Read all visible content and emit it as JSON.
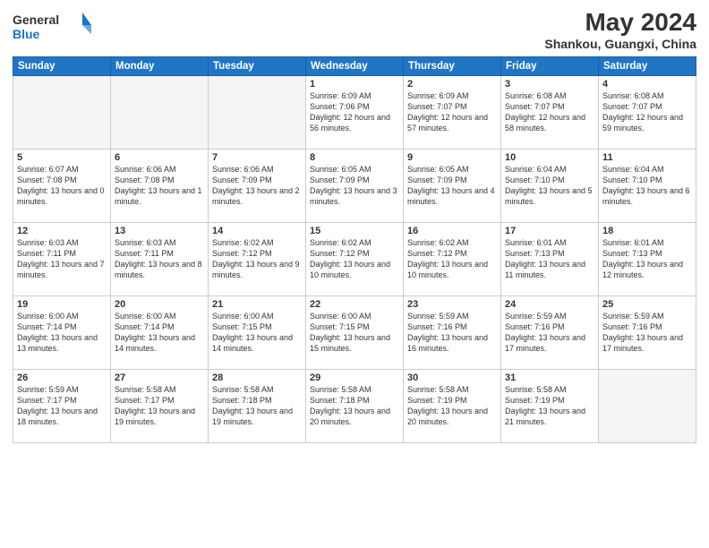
{
  "header": {
    "logo_line1": "General",
    "logo_line2": "Blue",
    "month_year": "May 2024",
    "location": "Shankou, Guangxi, China"
  },
  "weekdays": [
    "Sunday",
    "Monday",
    "Tuesday",
    "Wednesday",
    "Thursday",
    "Friday",
    "Saturday"
  ],
  "weeks": [
    [
      {
        "day": "",
        "sunrise": "",
        "sunset": "",
        "daylight": "",
        "empty": true
      },
      {
        "day": "",
        "sunrise": "",
        "sunset": "",
        "daylight": "",
        "empty": true
      },
      {
        "day": "",
        "sunrise": "",
        "sunset": "",
        "daylight": "",
        "empty": true
      },
      {
        "day": "1",
        "sunrise": "Sunrise: 6:09 AM",
        "sunset": "Sunset: 7:06 PM",
        "daylight": "Daylight: 12 hours and 56 minutes.",
        "empty": false
      },
      {
        "day": "2",
        "sunrise": "Sunrise: 6:09 AM",
        "sunset": "Sunset: 7:07 PM",
        "daylight": "Daylight: 12 hours and 57 minutes.",
        "empty": false
      },
      {
        "day": "3",
        "sunrise": "Sunrise: 6:08 AM",
        "sunset": "Sunset: 7:07 PM",
        "daylight": "Daylight: 12 hours and 58 minutes.",
        "empty": false
      },
      {
        "day": "4",
        "sunrise": "Sunrise: 6:08 AM",
        "sunset": "Sunset: 7:07 PM",
        "daylight": "Daylight: 12 hours and 59 minutes.",
        "empty": false
      }
    ],
    [
      {
        "day": "5",
        "sunrise": "Sunrise: 6:07 AM",
        "sunset": "Sunset: 7:08 PM",
        "daylight": "Daylight: 13 hours and 0 minutes.",
        "empty": false
      },
      {
        "day": "6",
        "sunrise": "Sunrise: 6:06 AM",
        "sunset": "Sunset: 7:08 PM",
        "daylight": "Daylight: 13 hours and 1 minute.",
        "empty": false
      },
      {
        "day": "7",
        "sunrise": "Sunrise: 6:06 AM",
        "sunset": "Sunset: 7:09 PM",
        "daylight": "Daylight: 13 hours and 2 minutes.",
        "empty": false
      },
      {
        "day": "8",
        "sunrise": "Sunrise: 6:05 AM",
        "sunset": "Sunset: 7:09 PM",
        "daylight": "Daylight: 13 hours and 3 minutes.",
        "empty": false
      },
      {
        "day": "9",
        "sunrise": "Sunrise: 6:05 AM",
        "sunset": "Sunset: 7:09 PM",
        "daylight": "Daylight: 13 hours and 4 minutes.",
        "empty": false
      },
      {
        "day": "10",
        "sunrise": "Sunrise: 6:04 AM",
        "sunset": "Sunset: 7:10 PM",
        "daylight": "Daylight: 13 hours and 5 minutes.",
        "empty": false
      },
      {
        "day": "11",
        "sunrise": "Sunrise: 6:04 AM",
        "sunset": "Sunset: 7:10 PM",
        "daylight": "Daylight: 13 hours and 6 minutes.",
        "empty": false
      }
    ],
    [
      {
        "day": "12",
        "sunrise": "Sunrise: 6:03 AM",
        "sunset": "Sunset: 7:11 PM",
        "daylight": "Daylight: 13 hours and 7 minutes.",
        "empty": false
      },
      {
        "day": "13",
        "sunrise": "Sunrise: 6:03 AM",
        "sunset": "Sunset: 7:11 PM",
        "daylight": "Daylight: 13 hours and 8 minutes.",
        "empty": false
      },
      {
        "day": "14",
        "sunrise": "Sunrise: 6:02 AM",
        "sunset": "Sunset: 7:12 PM",
        "daylight": "Daylight: 13 hours and 9 minutes.",
        "empty": false
      },
      {
        "day": "15",
        "sunrise": "Sunrise: 6:02 AM",
        "sunset": "Sunset: 7:12 PM",
        "daylight": "Daylight: 13 hours and 10 minutes.",
        "empty": false
      },
      {
        "day": "16",
        "sunrise": "Sunrise: 6:02 AM",
        "sunset": "Sunset: 7:12 PM",
        "daylight": "Daylight: 13 hours and 10 minutes.",
        "empty": false
      },
      {
        "day": "17",
        "sunrise": "Sunrise: 6:01 AM",
        "sunset": "Sunset: 7:13 PM",
        "daylight": "Daylight: 13 hours and 11 minutes.",
        "empty": false
      },
      {
        "day": "18",
        "sunrise": "Sunrise: 6:01 AM",
        "sunset": "Sunset: 7:13 PM",
        "daylight": "Daylight: 13 hours and 12 minutes.",
        "empty": false
      }
    ],
    [
      {
        "day": "19",
        "sunrise": "Sunrise: 6:00 AM",
        "sunset": "Sunset: 7:14 PM",
        "daylight": "Daylight: 13 hours and 13 minutes.",
        "empty": false
      },
      {
        "day": "20",
        "sunrise": "Sunrise: 6:00 AM",
        "sunset": "Sunset: 7:14 PM",
        "daylight": "Daylight: 13 hours and 14 minutes.",
        "empty": false
      },
      {
        "day": "21",
        "sunrise": "Sunrise: 6:00 AM",
        "sunset": "Sunset: 7:15 PM",
        "daylight": "Daylight: 13 hours and 14 minutes.",
        "empty": false
      },
      {
        "day": "22",
        "sunrise": "Sunrise: 6:00 AM",
        "sunset": "Sunset: 7:15 PM",
        "daylight": "Daylight: 13 hours and 15 minutes.",
        "empty": false
      },
      {
        "day": "23",
        "sunrise": "Sunrise: 5:59 AM",
        "sunset": "Sunset: 7:16 PM",
        "daylight": "Daylight: 13 hours and 16 minutes.",
        "empty": false
      },
      {
        "day": "24",
        "sunrise": "Sunrise: 5:59 AM",
        "sunset": "Sunset: 7:16 PM",
        "daylight": "Daylight: 13 hours and 17 minutes.",
        "empty": false
      },
      {
        "day": "25",
        "sunrise": "Sunrise: 5:59 AM",
        "sunset": "Sunset: 7:16 PM",
        "daylight": "Daylight: 13 hours and 17 minutes.",
        "empty": false
      }
    ],
    [
      {
        "day": "26",
        "sunrise": "Sunrise: 5:59 AM",
        "sunset": "Sunset: 7:17 PM",
        "daylight": "Daylight: 13 hours and 18 minutes.",
        "empty": false
      },
      {
        "day": "27",
        "sunrise": "Sunrise: 5:58 AM",
        "sunset": "Sunset: 7:17 PM",
        "daylight": "Daylight: 13 hours and 19 minutes.",
        "empty": false
      },
      {
        "day": "28",
        "sunrise": "Sunrise: 5:58 AM",
        "sunset": "Sunset: 7:18 PM",
        "daylight": "Daylight: 13 hours and 19 minutes.",
        "empty": false
      },
      {
        "day": "29",
        "sunrise": "Sunrise: 5:58 AM",
        "sunset": "Sunset: 7:18 PM",
        "daylight": "Daylight: 13 hours and 20 minutes.",
        "empty": false
      },
      {
        "day": "30",
        "sunrise": "Sunrise: 5:58 AM",
        "sunset": "Sunset: 7:19 PM",
        "daylight": "Daylight: 13 hours and 20 minutes.",
        "empty": false
      },
      {
        "day": "31",
        "sunrise": "Sunrise: 5:58 AM",
        "sunset": "Sunset: 7:19 PM",
        "daylight": "Daylight: 13 hours and 21 minutes.",
        "empty": false
      },
      {
        "day": "",
        "sunrise": "",
        "sunset": "",
        "daylight": "",
        "empty": true
      }
    ]
  ]
}
